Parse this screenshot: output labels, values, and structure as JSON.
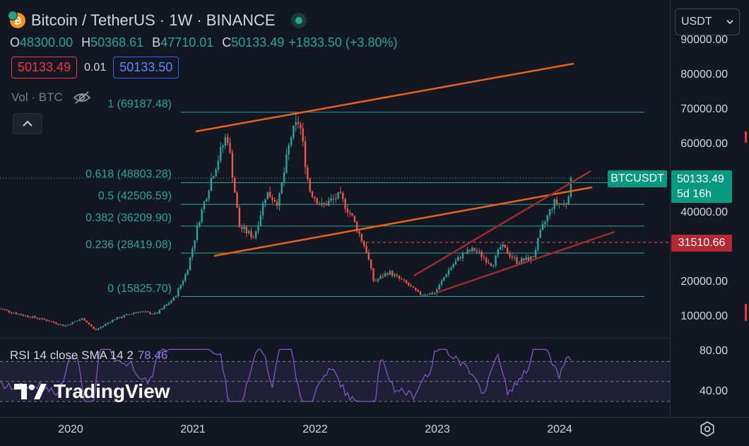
{
  "symbol": {
    "title": "Bitcoin / TetherUS · 1W · BINANCE",
    "coin_icon": "bitcoin-icon",
    "status_icon": "market-open-dot-icon"
  },
  "ohlc": {
    "o_label": "O",
    "o_value": "48300.00",
    "h_label": "H",
    "h_value": "50368.61",
    "l_label": "B",
    "l_value": "47710.01",
    "c_label": "C",
    "c_value": "50133.49",
    "change": "+1833.50 (+3.80%)"
  },
  "trade": {
    "sell_price": "50133.49",
    "spread": "0.01",
    "buy_price": "50133.50"
  },
  "volume": {
    "label": "Vol · BTC",
    "hidden_icon": "eye-crossed-icon"
  },
  "currency_select": {
    "value": "USDT"
  },
  "price_axis": {
    "ticks": [
      "90000.00",
      "80000.00",
      "70000.00",
      "60000.00",
      "50000.00",
      "40000.00",
      "30000.00",
      "20000.00",
      "10000.00"
    ],
    "rsi_ticks": [
      "80.00",
      "40.00"
    ]
  },
  "time_axis": {
    "ticks": [
      "2020",
      "2021",
      "2022",
      "2023",
      "2024"
    ]
  },
  "tags": {
    "symbol_name": "BTCUSDT",
    "last_price": "50133.49",
    "countdown": "5d 16h",
    "level_price": "31510.66"
  },
  "fib_levels": [
    {
      "label": "1 (69187.48)",
      "price": 69187.48
    },
    {
      "label": "0.618 (48803.28)",
      "price": 48803.28
    },
    {
      "label": "0.5 (42506.59)",
      "price": 42506.59
    },
    {
      "label": "0.382 (36209.90)",
      "price": 36209.9
    },
    {
      "label": "0.236 (28419.08)",
      "price": 28419.08
    },
    {
      "label": "0 (15825.70)",
      "price": 15825.7
    }
  ],
  "rsi": {
    "label": "RSI 14 close SMA 14 2",
    "value": "78.46"
  },
  "branding": {
    "name": "TradingView"
  },
  "colors": {
    "up": "#26a69a",
    "down": "#ef5350",
    "channel": "#e8621a",
    "channel_dark": "#9c2b30",
    "rsi": "#7e57c2",
    "fib": "#26a69a"
  },
  "chart_data": {
    "type": "candlestick",
    "interval": "1W",
    "price_scale": [
      10000,
      90000
    ],
    "series": [
      {
        "name": "BTCUSDT",
        "close_path": [
          [
            2019.4,
            12500
          ],
          [
            2019.6,
            10500
          ],
          [
            2019.8,
            9000
          ],
          [
            2019.95,
            7300
          ],
          [
            2020.1,
            9500
          ],
          [
            2020.2,
            6000
          ],
          [
            2020.35,
            9200
          ],
          [
            2020.55,
            11500
          ],
          [
            2020.7,
            10800
          ],
          [
            2020.85,
            15500
          ],
          [
            2020.95,
            23000
          ],
          [
            2021.05,
            38000
          ],
          [
            2021.15,
            50000
          ],
          [
            2021.28,
            63000
          ],
          [
            2021.38,
            36000
          ],
          [
            2021.5,
            33000
          ],
          [
            2021.6,
            46000
          ],
          [
            2021.7,
            43000
          ],
          [
            2021.8,
            62000
          ],
          [
            2021.87,
            67000
          ],
          [
            2021.95,
            47000
          ],
          [
            2022.05,
            42000
          ],
          [
            2022.2,
            45000
          ],
          [
            2022.3,
            39000
          ],
          [
            2022.42,
            29000
          ],
          [
            2022.48,
            20000
          ],
          [
            2022.6,
            23000
          ],
          [
            2022.75,
            19500
          ],
          [
            2022.85,
            16500
          ],
          [
            2022.98,
            16800
          ],
          [
            2023.08,
            23000
          ],
          [
            2023.2,
            28000
          ],
          [
            2023.3,
            29500
          ],
          [
            2023.45,
            25000
          ],
          [
            2023.52,
            30500
          ],
          [
            2023.65,
            26000
          ],
          [
            2023.78,
            27000
          ],
          [
            2023.85,
            35000
          ],
          [
            2023.95,
            43000
          ],
          [
            2024.05,
            42500
          ],
          [
            2024.1,
            50133
          ]
        ]
      }
    ],
    "rsi_range": [
      40,
      80
    ]
  }
}
